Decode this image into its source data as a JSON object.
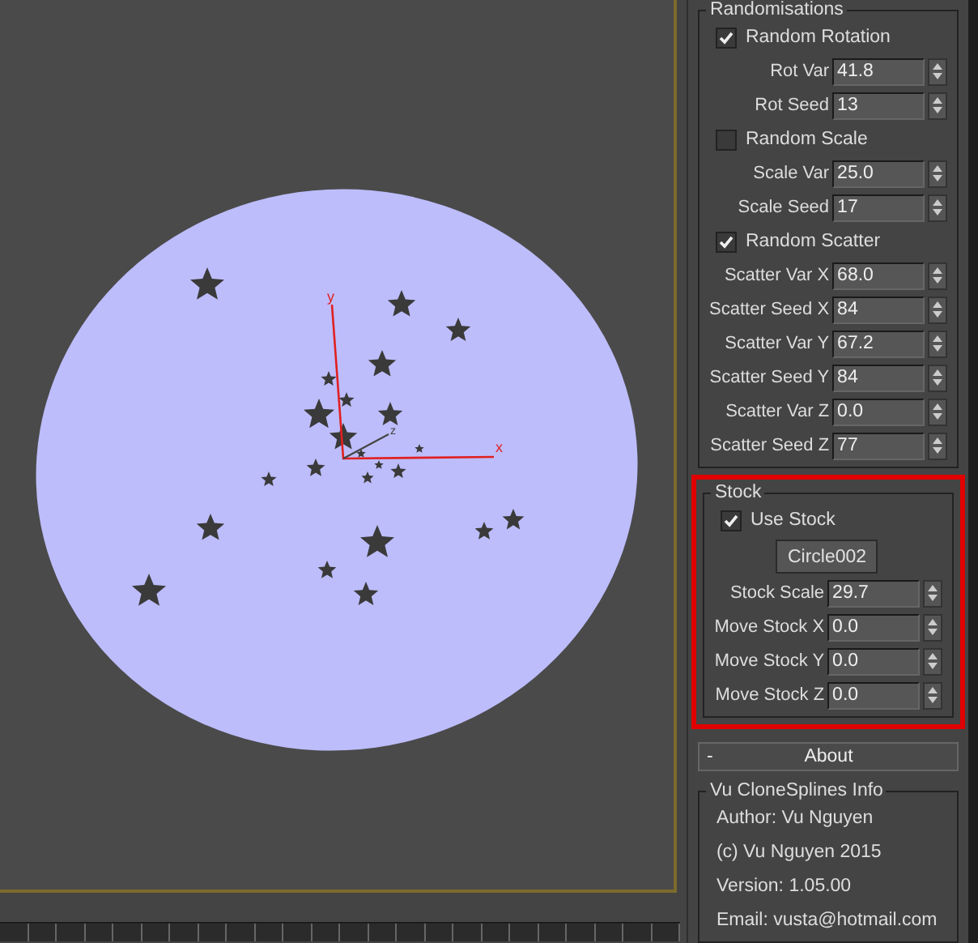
{
  "viewport": {
    "axis_labels": [
      "y",
      "x",
      "z"
    ]
  },
  "randomisations": {
    "title": "Randomisations",
    "items": [
      {
        "kind": "checkbox",
        "label": "Random Rotation",
        "checked": true
      },
      {
        "kind": "spinner",
        "label": "Rot Var",
        "value": "41.8"
      },
      {
        "kind": "spinner",
        "label": "Rot Seed",
        "value": "13"
      },
      {
        "kind": "checkbox",
        "label": "Random Scale",
        "checked": false
      },
      {
        "kind": "spinner",
        "label": "Scale Var",
        "value": "25.0"
      },
      {
        "kind": "spinner",
        "label": "Scale Seed",
        "value": "17"
      },
      {
        "kind": "checkbox",
        "label": "Random Scatter",
        "checked": true
      },
      {
        "kind": "spinner",
        "label": "Scatter Var X",
        "value": "68.0"
      },
      {
        "kind": "spinner",
        "label": "Scatter Seed X",
        "value": "84"
      },
      {
        "kind": "spinner",
        "label": "Scatter Var Y",
        "value": "67.2"
      },
      {
        "kind": "spinner",
        "label": "Scatter Seed Y",
        "value": "84"
      },
      {
        "kind": "spinner",
        "label": "Scatter Var Z",
        "value": "0.0"
      },
      {
        "kind": "spinner",
        "label": "Scatter Seed Z",
        "value": "77"
      }
    ]
  },
  "stock": {
    "title": "Stock",
    "highlighted": true,
    "items": [
      {
        "kind": "checkbox",
        "label": "Use Stock",
        "checked": true
      },
      {
        "kind": "button",
        "label": "Circle002"
      },
      {
        "kind": "spinner",
        "label": "Stock Scale",
        "value": "29.7"
      },
      {
        "kind": "spinner",
        "label": "Move Stock X",
        "value": "0.0"
      },
      {
        "kind": "spinner",
        "label": "Move Stock Y",
        "value": "0.0"
      },
      {
        "kind": "spinner",
        "label": "Move Stock Z",
        "value": "0.0"
      }
    ]
  },
  "about": {
    "toggle": "-",
    "title": "About",
    "group_title": "Vu CloneSplines Info",
    "lines": [
      "Author: Vu Nguyen",
      "(c) Vu Nguyen 2015",
      "Version: 1.05.00",
      "Email: vusta@hotmail.com"
    ]
  }
}
